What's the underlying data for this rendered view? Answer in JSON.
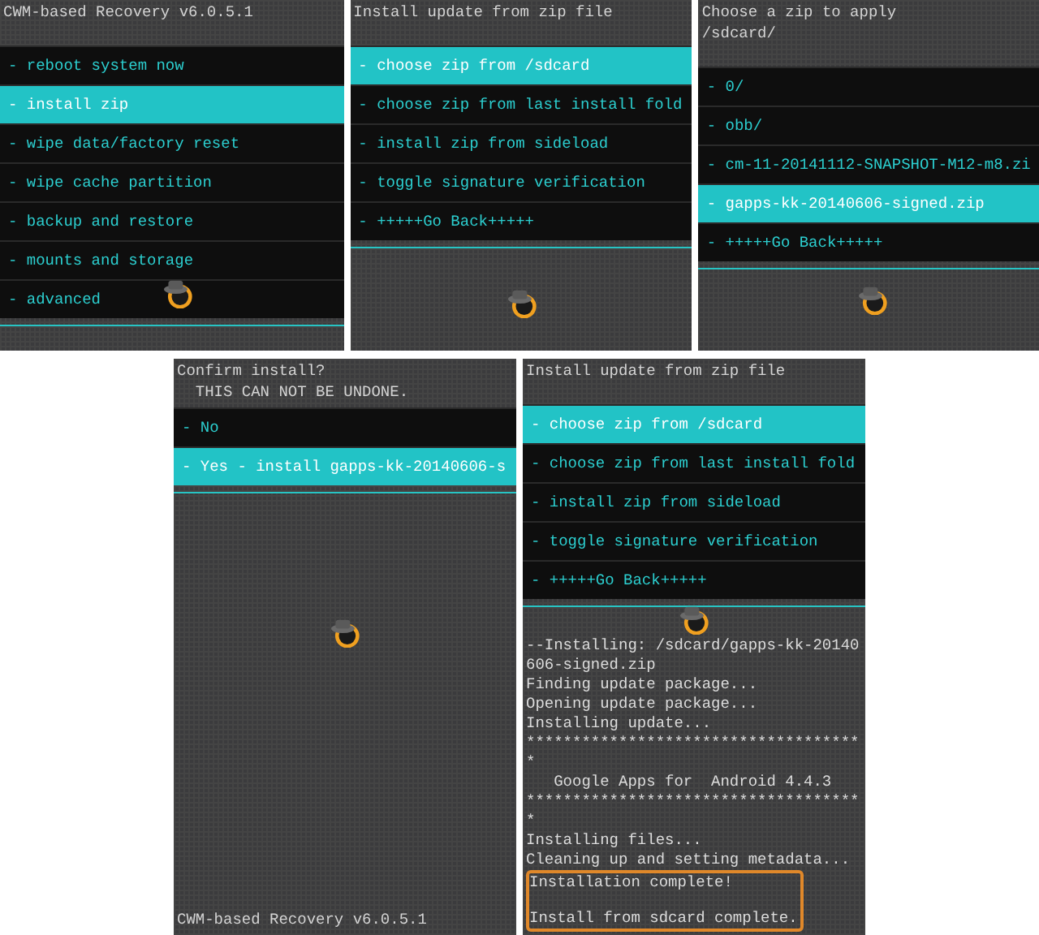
{
  "screens": [
    {
      "header": [
        "CWM-based Recovery v6.0.5.1"
      ],
      "menu": [
        {
          "label": "- reboot system now",
          "selected": false
        },
        {
          "label": "- install zip",
          "selected": true
        },
        {
          "label": "- wipe data/factory reset",
          "selected": false
        },
        {
          "label": "- wipe cache partition",
          "selected": false
        },
        {
          "label": "- backup and restore",
          "selected": false
        },
        {
          "label": "- mounts and storage",
          "selected": false
        },
        {
          "label": "- advanced",
          "selected": false
        }
      ]
    },
    {
      "header": [
        "Install update from zip file"
      ],
      "menu": [
        {
          "label": "- choose zip from /sdcard",
          "selected": true
        },
        {
          "label": "- choose zip from last install fold",
          "selected": false
        },
        {
          "label": "- install zip from sideload",
          "selected": false
        },
        {
          "label": "- toggle signature verification",
          "selected": false
        },
        {
          "label": "- +++++Go Back+++++",
          "selected": false
        }
      ]
    },
    {
      "header": [
        "Choose a zip to apply",
        "/sdcard/"
      ],
      "menu": [
        {
          "label": "- 0/",
          "selected": false
        },
        {
          "label": "- obb/",
          "selected": false
        },
        {
          "label": "- cm-11-20141112-SNAPSHOT-M12-m8.zi",
          "selected": false
        },
        {
          "label": "- gapps-kk-20140606-signed.zip",
          "selected": true
        },
        {
          "label": "- +++++Go Back+++++",
          "selected": false
        }
      ]
    },
    {
      "header": [
        "Confirm install?",
        "  THIS CAN NOT BE UNDONE."
      ],
      "menu": [
        {
          "label": "- No",
          "selected": false
        },
        {
          "label": "- Yes - install gapps-kk-20140606-s",
          "selected": true
        }
      ],
      "footer": "CWM-based Recovery v6.0.5.1"
    },
    {
      "header": [
        "Install update from zip file"
      ],
      "menu": [
        {
          "label": "- choose zip from /sdcard",
          "selected": true
        },
        {
          "label": "- choose zip from last install fold",
          "selected": false
        },
        {
          "label": "- install zip from sideload",
          "selected": false
        },
        {
          "label": "- toggle signature verification",
          "selected": false
        },
        {
          "label": "- +++++Go Back+++++",
          "selected": false
        }
      ],
      "log": [
        "--Installing: /sdcard/gapps-kk-20140",
        "606-signed.zip",
        "Finding update package...",
        "Opening update package...",
        "Installing update...",
        "************************************",
        "*",
        "   Google Apps for  Android 4.4.3",
        "************************************",
        "*",
        "Installing files...",
        "Cleaning up and setting metadata..."
      ],
      "log_highlighted": [
        "Installation complete!",
        "Install from sdcard complete."
      ]
    }
  ]
}
